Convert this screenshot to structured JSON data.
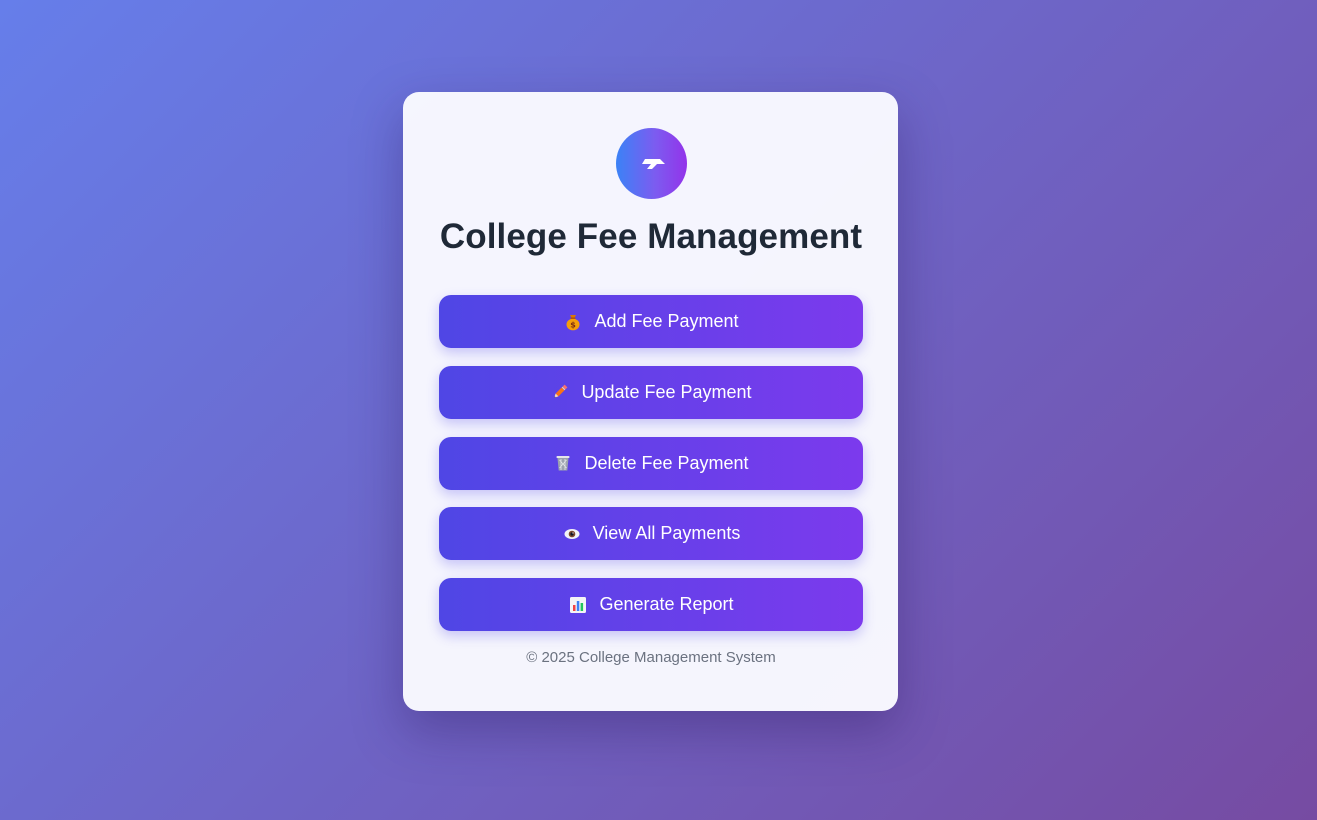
{
  "app": {
    "title": "College Fee Management",
    "logo_icon": "graduation-cap-icon"
  },
  "actions": [
    {
      "label": "Add Fee Payment",
      "icon": "money-bag-icon"
    },
    {
      "label": "Update Fee Payment",
      "icon": "pencil-icon"
    },
    {
      "label": "Delete Fee Payment",
      "icon": "wastebasket-icon"
    },
    {
      "label": "View All Payments",
      "icon": "eye-icon"
    },
    {
      "label": "Generate Report",
      "icon": "bar-chart-icon"
    }
  ],
  "footer": {
    "text": "© 2025 College Management System"
  },
  "colors": {
    "background_start": "#667eea",
    "background_end": "#764ba2",
    "button_start": "#4f46e5",
    "button_end": "#7c3aed",
    "title": "#1f2937",
    "footer": "#6b7280"
  }
}
